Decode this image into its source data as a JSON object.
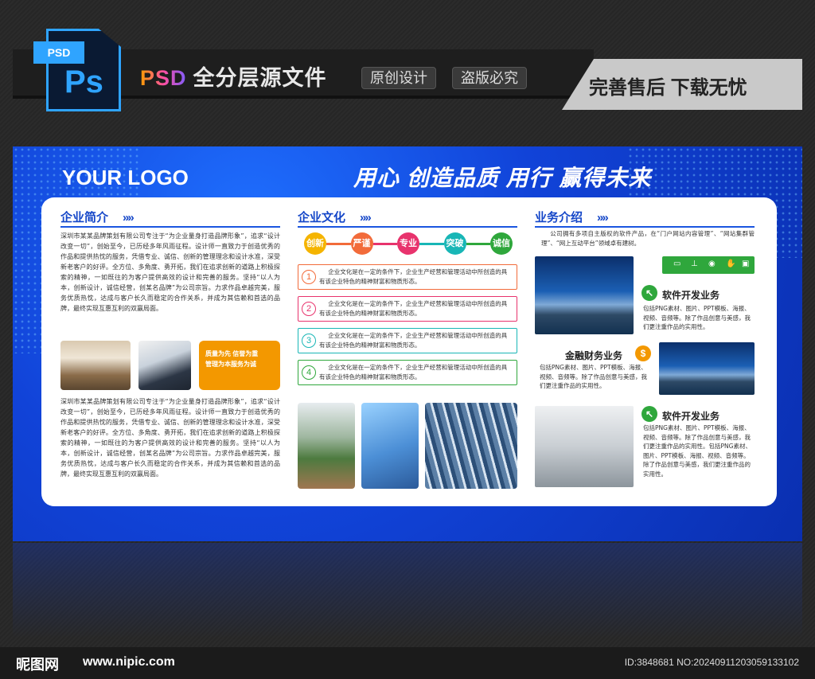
{
  "banner": {
    "file_badge": "PSD",
    "file_icon": "Ps",
    "title_prefix": "PSD",
    "title": "全分层源文件",
    "tag1": "原创设计",
    "tag2": "盗版必究",
    "right_text": "完善售后 下载无忧"
  },
  "board": {
    "logo": "YOUR LOGO",
    "slogan": "用心 创造品质  用行 赢得未来",
    "colors": {
      "primary_blue": "#1143d8",
      "accent_orange": "#f39800",
      "accent_green": "#2fa73c"
    }
  },
  "intro": {
    "title": "企业简介",
    "arrows": "»»",
    "para1": "深圳市某某品牌策划有限公司专注于“为企业量身打造品牌形象”，追求“设计改变一切”，创始至今，已历经多年风雨征程。设计师一直致力于创造优秀的作品和提供热忱的服务，凭借专业、诚信、创新的管理理念和设计水准，深受新老客户的好评。全方位、多角度、勇开拓，我们在追求创新的道路上积极探索的精神，一如既往的为客户提供高效的设计和完善的服务。坚持“以人为本，创新设计，诚信经营，创某名品牌”为公司宗旨。力求作品卓越完美，服务优质热忱，达成与客户长久而稳定的合作关系，并成为其信赖和首选的品牌，最终实现互惠互利的双赢局面。",
    "orange_box": "质量为先 信誉为重\n管理为本服务为诚",
    "para2": "深圳市某某品牌策划有限公司专注于“为企业量身打造品牌形象”，追求“设计改变一切”，创始至今，已历经多年风雨征程。设计师一直致力于创造优秀的作品和提供热忱的服务，凭借专业、诚信、创新的管理理念和设计水准，深受新老客户的好评。全方位、多角度、勇开拓，我们在追求创新的道路上积极探索的精神，一如既往的为客户提供高效的设计和完善的服务。坚持“以人为本，创新设计，诚信经营，创某名品牌”为公司宗旨。力求作品卓越完美，服务优质热忱，达成与客户长久而稳定的合作关系，并成为其信赖和首选的品牌，最终实现互惠互利的双赢局面。"
  },
  "culture": {
    "title": "企业文化",
    "arrows": "»»",
    "values": [
      {
        "label": "创新",
        "color": "#f5b400"
      },
      {
        "label": "严谨",
        "color": "#f26b3a"
      },
      {
        "label": "专业",
        "color": "#e8336d"
      },
      {
        "label": "突破",
        "color": "#18b6b6"
      },
      {
        "label": "诚信",
        "color": "#2fa73c"
      }
    ],
    "items": [
      {
        "num": "1",
        "text": "企业文化是在一定的条件下，企业生产经营和管理活动中所创造的具有该企业特色的精神财富和物质形态。",
        "color": "#f26b3a"
      },
      {
        "num": "2",
        "text": "企业文化是在一定的条件下，企业生产经营和管理活动中所创造的具有该企业特色的精神财富和物质形态。",
        "color": "#e8336d"
      },
      {
        "num": "3",
        "text": "企业文化是在一定的条件下，企业生产经营和管理活动中所创造的具有该企业特色的精神财富和物质形态。",
        "color": "#18b6b6"
      },
      {
        "num": "4",
        "text": "企业文化是在一定的条件下，企业生产经营和管理活动中所创造的具有该企业特色的精神财富和物质形态。",
        "color": "#2fa73c"
      }
    ]
  },
  "business": {
    "title": "业务介绍",
    "arrows": "»»",
    "intro": "公司拥有多项自主版权的软件产品，在“门户网站内容管理”、“网站集群管理”、“网上互动平台”领域卓有建树。",
    "items": [
      {
        "title": "软件开发业务",
        "text": "包括PNG素材、图片、PPT模板、海报、视频、音频等。除了作品创意与美感，我们更注重作品的实用性。"
      },
      {
        "title": "金融财务业务",
        "text": "包括PNG素材、图片、PPT模板、海报、视频、音频等。除了作品创意与美感，我们更注重作品的实用性。"
      },
      {
        "title": "软件开发业务",
        "text": "包括PNG素材、图片、PPT模板、海报、视频、音频等。除了作品创意与美感，我们更注重作品的实用性。包括PNG素材、图片、PPT模板、海报、视频、音频等。除了作品创意与美感，我们更注重作品的实用性。"
      }
    ]
  },
  "footer": {
    "site_name": "昵图网",
    "url": "www.nipic.com",
    "id_text": "ID:3848681 NO:20240911203059133102"
  }
}
